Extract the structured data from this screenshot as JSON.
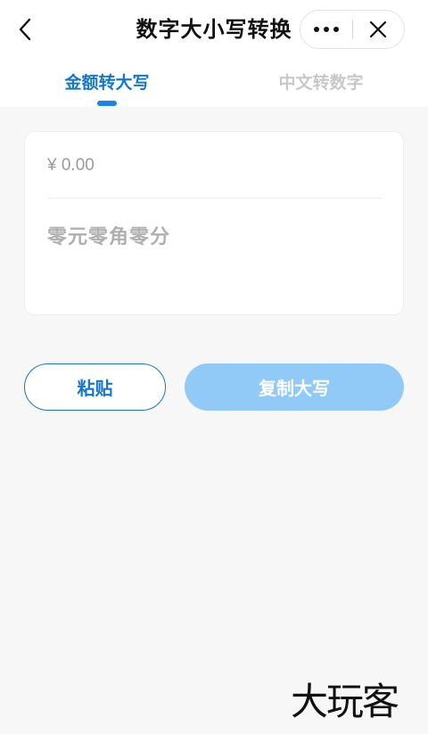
{
  "nav": {
    "title": "数字大小写转换",
    "back_icon": "chevron-left-icon",
    "more_icon": "more-dots-icon",
    "close_icon": "close-icon"
  },
  "tabs": [
    {
      "label": "金额转大写",
      "active": true
    },
    {
      "label": "中文转数字",
      "active": false
    }
  ],
  "converter": {
    "amount_placeholder": "¥ 0.00",
    "amount_value": "",
    "result_text": "零元零角零分"
  },
  "actions": {
    "paste_label": "粘贴",
    "copy_label": "复制大写"
  },
  "watermark": "大玩客",
  "colors": {
    "accent": "#1677c8",
    "tab_indicator": "#1a83e6",
    "copy_button_bg": "#91c9f7",
    "inactive_tab": "#c8c8c8",
    "background": "#f7f7f7"
  }
}
